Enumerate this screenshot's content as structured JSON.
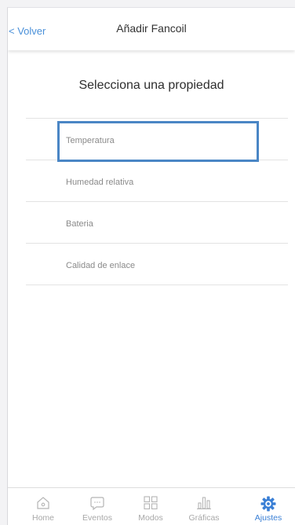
{
  "header": {
    "back_label": "< Volver",
    "title": "Añadir Fancoil"
  },
  "main": {
    "title": "Selecciona una propiedad",
    "items": [
      {
        "label": "Temperatura",
        "selected": true
      },
      {
        "label": "Humedad relativa"
      },
      {
        "label": "Bateria"
      },
      {
        "label": "Calidad de enlace"
      }
    ]
  },
  "tabbar": {
    "tabs": [
      {
        "label": "Home",
        "icon": "home-icon"
      },
      {
        "label": "Eventos",
        "icon": "chat-icon"
      },
      {
        "label": "Modos",
        "icon": "grid-icon"
      },
      {
        "label": "Gráficas",
        "icon": "bar-chart-icon"
      },
      {
        "label": "Ajustes",
        "icon": "gear-icon",
        "active": true
      }
    ]
  },
  "colors": {
    "accent": "#4a90d9",
    "selection": "#4a86c5",
    "active_tab": "#3a7fd5",
    "inactive": "#a8a8a8"
  }
}
